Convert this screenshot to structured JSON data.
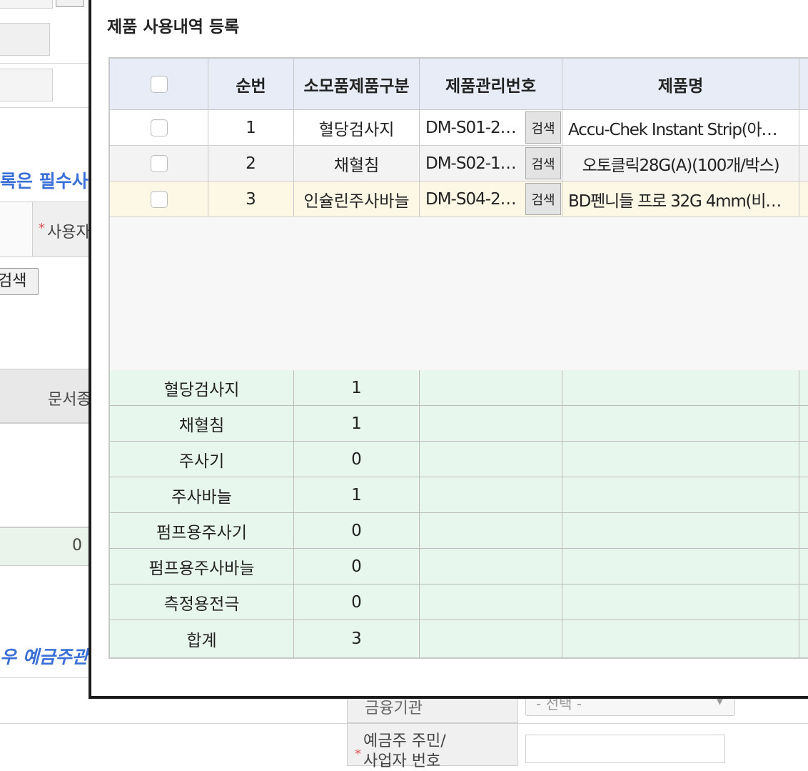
{
  "background": {
    "search_button": "검색",
    "required_text": "록은 필수사",
    "user_label_prefix": "*",
    "user_label": "사용자",
    "doc_label": "문서종",
    "zero_value": "0",
    "depositor_text": "우 예금주관",
    "bank_label": "금융기관",
    "bank_select": "- 선택 -",
    "depositor_id_label_1": "예금주 주민/",
    "depositor_id_label_2": "사업자 번호"
  },
  "modal": {
    "title": "제품 사용내역 등록",
    "columns": {
      "seq": "순번",
      "category": "소모품제품구분",
      "code": "제품관리번호",
      "name": "제품명"
    },
    "search_label": "검색",
    "rows": [
      {
        "seq": "1",
        "category": "혈당검사지",
        "code": "DM-S01-2…",
        "name": "Accu-Chek Instant Strip(아…"
      },
      {
        "seq": "2",
        "category": "채혈침",
        "code": "DM-S02-1…",
        "name": "오토클릭28G(A)(100개/박스)"
      },
      {
        "seq": "3",
        "category": "인슐린주사바늘",
        "code": "DM-S04-2…",
        "name": "BD펜니들 프로 32G 4mm(비…"
      }
    ],
    "summary": [
      {
        "label": "혈당검사지",
        "count": "1"
      },
      {
        "label": "채혈침",
        "count": "1"
      },
      {
        "label": "주사기",
        "count": "0"
      },
      {
        "label": "주사바늘",
        "count": "1"
      },
      {
        "label": "펌프용주사기",
        "count": "0"
      },
      {
        "label": "펌프용주사바늘",
        "count": "0"
      },
      {
        "label": "측정용전극",
        "count": "0"
      },
      {
        "label": "합계",
        "count": "3"
      }
    ]
  }
}
